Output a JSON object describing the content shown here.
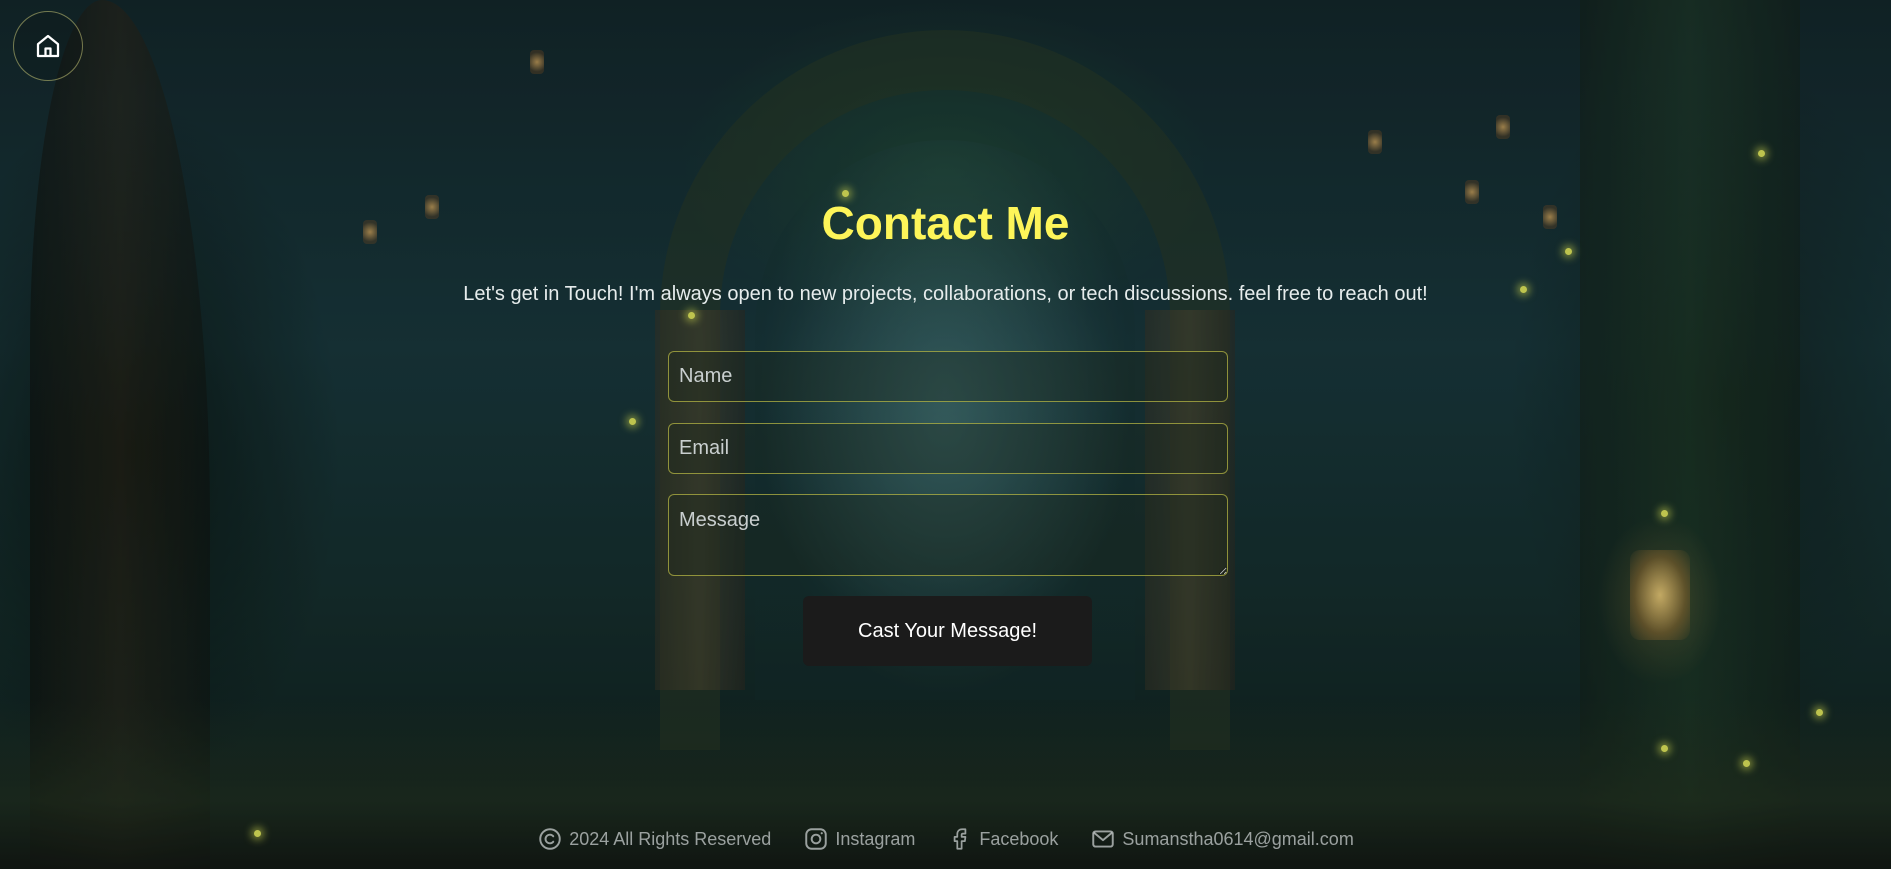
{
  "nav": {
    "home_icon": "home-icon"
  },
  "main": {
    "title": "Contact Me",
    "subtitle": "Let's get in Touch! I'm always open to new projects, collaborations, or tech discussions. feel free to reach out!"
  },
  "form": {
    "name_placeholder": "Name",
    "email_placeholder": "Email",
    "message_placeholder": "Message",
    "submit_label": "Cast Your Message!"
  },
  "footer": {
    "copyright": "2024 All Rights Reserved",
    "instagram_label": "Instagram",
    "facebook_label": "Facebook",
    "email_label": "Sumanstha0614@gmail.com",
    "icons": [
      "copyright-icon",
      "instagram-icon",
      "facebook-icon",
      "mail-icon"
    ]
  },
  "colors": {
    "accent": "#fdf559",
    "button_bg": "#1b1b1b",
    "field_border": "#bebe46"
  }
}
